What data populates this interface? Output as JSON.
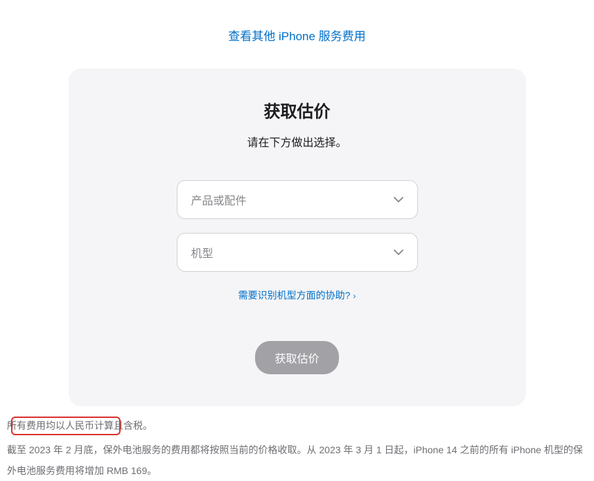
{
  "topLink": "查看其他 iPhone 服务费用",
  "card": {
    "title": "获取估价",
    "subtitle": "请在下方做出选择。",
    "select1": "产品或配件",
    "select2": "机型",
    "helpLink": "需要识别机型方面的协助?",
    "submit": "获取估价"
  },
  "footer": {
    "line1": "所有费用均以人民币计算且含税。",
    "line2": "截至 2023 年 2 月底，保外电池服务的费用都将按照当前的价格收取。从 2023 年 3 月 1 日起，iPhone 14 之前的所有 iPhone 机型的保外电池服务费用将增加 RMB 169。"
  }
}
